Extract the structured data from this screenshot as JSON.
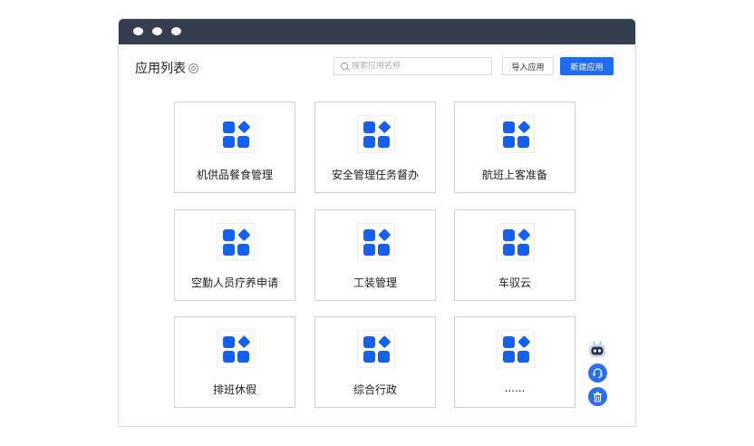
{
  "page_title": "应用列表",
  "search": {
    "placeholder": "搜索应用名称",
    "value": ""
  },
  "buttons": {
    "import": "导入应用",
    "new": "新建应用"
  },
  "apps": [
    {
      "label": "机供品餐食管理"
    },
    {
      "label": "安全管理任务督办"
    },
    {
      "label": "航班上客准备"
    },
    {
      "label": "空勤人员疗养申请"
    },
    {
      "label": "工装管理"
    },
    {
      "label": "车驭云"
    },
    {
      "label": "排班休假"
    },
    {
      "label": "综合行政"
    },
    {
      "label": "......"
    }
  ],
  "colors": {
    "accent": "#1e6bf5",
    "titlebar": "#343e4e",
    "app_icon": "#1460f0"
  },
  "floating_actions": [
    "robot-assistant-icon",
    "customer-service-icon",
    "trash-icon"
  ]
}
